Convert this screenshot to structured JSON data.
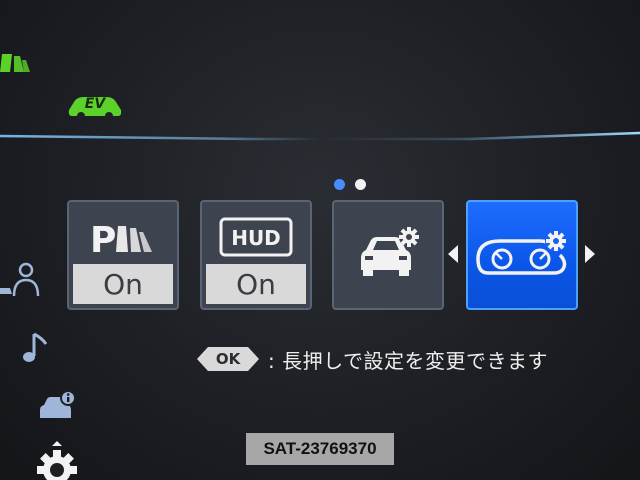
{
  "indicators": {
    "parking": "parking-sensor-icon",
    "ev": {
      "label": "EV",
      "color": "#5cd12a"
    }
  },
  "pagination": {
    "dots": [
      "active-blue",
      "white"
    ],
    "active_color": "#4a8cff"
  },
  "tiles": [
    {
      "icon": "parking-sensor-icon",
      "status": "On",
      "selected": false
    },
    {
      "icon": "hud-icon",
      "icon_text": "HUD",
      "status": "On",
      "selected": false
    },
    {
      "icon": "vehicle-settings-icon",
      "selected": false
    },
    {
      "icon": "meter-settings-icon",
      "selected": true,
      "selected_color": "#1f6dff"
    }
  ],
  "sidebar": {
    "icons": [
      "driver-assist-icon",
      "music-note-icon",
      "car-info-icon",
      "settings-gear-icon"
    ]
  },
  "hint": {
    "button": "OK",
    "text": ": 長押しで設定を変更できます"
  },
  "watermark": "SAT-23769370"
}
